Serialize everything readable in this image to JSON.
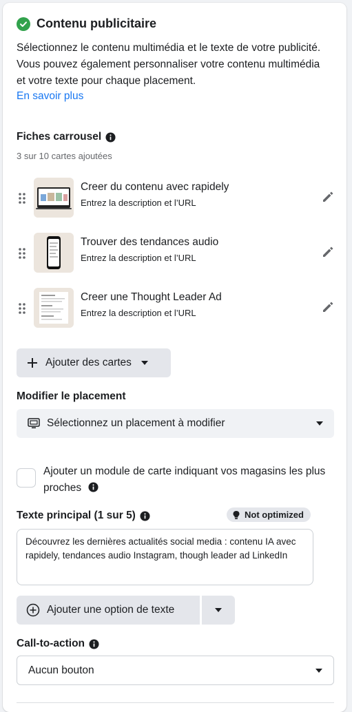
{
  "section": {
    "title": "Contenu publicitaire",
    "description": "Sélectionnez le contenu multimédia et le texte de votre publicité. Vous pouvez également personnaliser votre contenu multimédia et votre texte pour chaque placement.",
    "learn_more": "En savoir plus"
  },
  "carousel": {
    "title": "Fiches carrousel",
    "count_text": "3 sur 10 cartes ajoutées",
    "cards": [
      {
        "title": "Creer du contenu avec rapidely",
        "subtitle": "Entrez la description et l’URL"
      },
      {
        "title": "Trouver des tendances audio",
        "subtitle": "Entrez la description et l’URL"
      },
      {
        "title": "Creer une Thought Leader Ad",
        "subtitle": "Entrez la description et l’URL"
      }
    ],
    "add_button": "Ajouter des cartes"
  },
  "placement": {
    "title": "Modifier le placement",
    "select_value": "Sélectionnez un placement à modifier"
  },
  "map_module": {
    "label": "Ajouter un module de carte indiquant vos magasins les plus proches",
    "checked": false
  },
  "primary_text": {
    "title": "Texte principal (1 sur 5)",
    "badge": "Not optimized",
    "value": "Découvrez les dernières actualités social media : contenu IA avec rapidely, tendances audio Instagram, though leader ad LinkedIn",
    "add_option": "Ajouter une option de texte"
  },
  "cta": {
    "title": "Call-to-action",
    "value": "Aucun bouton"
  },
  "colors": {
    "accent": "#1877f2",
    "success": "#31a24c",
    "button_bg": "#e4e6eb"
  }
}
